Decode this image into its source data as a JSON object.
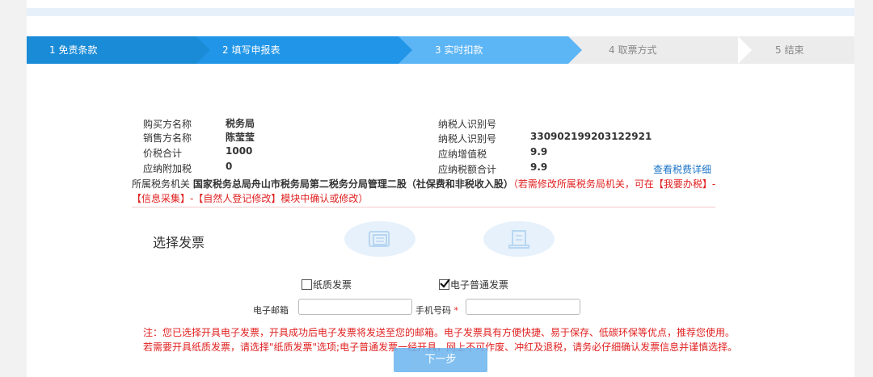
{
  "steps": [
    {
      "label": "1  免责条款"
    },
    {
      "label": "2  填写申报表"
    },
    {
      "label": "3  实时扣款"
    },
    {
      "label": "4  取票方式"
    },
    {
      "label": "5  结束"
    }
  ],
  "info": {
    "buyer_label": "购买方名称",
    "buyer_value": "税务局",
    "seller_label": "销售方名称",
    "seller_value": "陈莹莹",
    "total_label": "价税合计",
    "total_value": "1000",
    "surcharge_label": "应纳附加税",
    "surcharge_value": "0",
    "taxpayer_id_label_1": "纳税人识别号",
    "taxpayer_id_label_2": "纳税人识别号",
    "taxpayer_id_value": "330902199203122921",
    "vat_label": "应纳增值税",
    "vat_value": "9.9",
    "tax_total_label": "应纳税额合计",
    "tax_total_value": "9.9",
    "fee_detail_link": "查看税费详细"
  },
  "office": {
    "label": "所属税务机关",
    "name": "国家税务总局舟山市税务局第二税务分局管理二股（社保费和非税收入股）",
    "hint": "（若需修改所属税务局机关，可在【我要办税】-【信息采集】-【自然人登记修改】模块中确认或修改）"
  },
  "invoice": {
    "title": "选择发票",
    "paper_label": "纸质发票",
    "paper_checked": false,
    "electronic_label": "电子普通发票",
    "electronic_checked": true,
    "email_label": "电子邮箱",
    "email_value": "",
    "phone_label": "手机号码",
    "phone_required_mark": "*",
    "phone_value": ""
  },
  "note": "注：您已选择开具电子发票，开具成功后电子发票将发送至您的邮箱。电子发票具有方便快捷、易于保存、低碳环保等优点，推荐您使用。若需要开具纸质发票，请选择\"纸质发票\"选项;电子普通发票一经开具，网上不可作废、冲红及退税，请务必仔细确认发票信息并谨慎选择。",
  "next_button": "下一步",
  "colors": {
    "step_active_1": "#1a8bd6",
    "step_active_2": "#2196e8",
    "step_current": "#5cb5f5",
    "step_inactive": "#ececec",
    "link": "#1a73c7",
    "warning": "#e02020"
  }
}
